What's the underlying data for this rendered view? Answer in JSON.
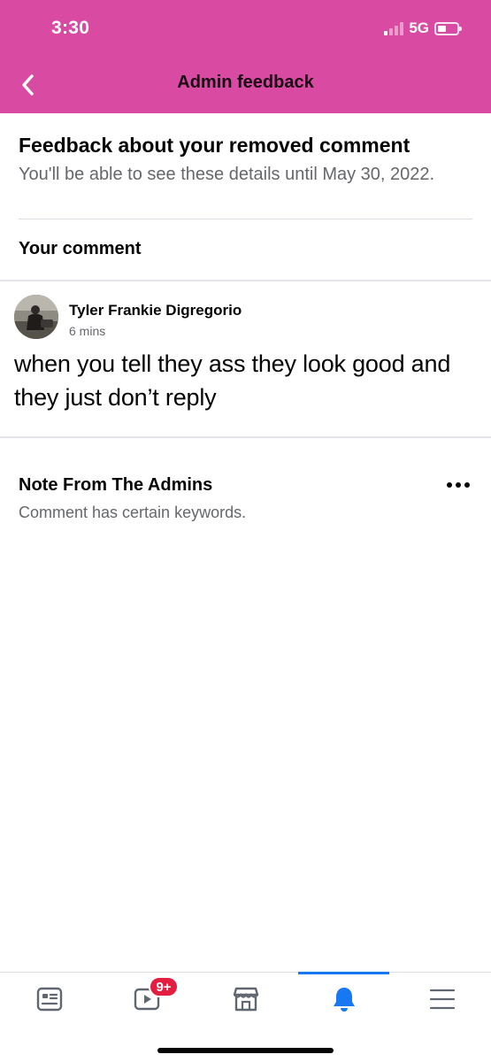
{
  "status_bar": {
    "time": "3:30",
    "network": "5G"
  },
  "header": {
    "title": "Admin feedback",
    "back_icon": "chevron-left-icon",
    "background_color": "#d94ba3"
  },
  "feedback": {
    "title": "Feedback about your removed comment",
    "subtitle": "You'll be able to see these details until May 30, 2022.",
    "section_label": "Your comment"
  },
  "comment": {
    "author": "Tyler Frankie Digregorio",
    "time": "6 mins",
    "text": "when you tell they ass they look good and they just don’t reply"
  },
  "note": {
    "title": "Note From The Admins",
    "text": "Comment has certain keywords.",
    "more_icon": "more-horizontal-icon"
  },
  "tabbar": {
    "tabs": [
      {
        "name": "tab-news-feed",
        "icon": "news-feed-icon"
      },
      {
        "name": "tab-watch",
        "icon": "video-icon"
      },
      {
        "name": "tab-marketplace",
        "icon": "store-icon"
      },
      {
        "name": "tab-notifications",
        "icon": "bell-icon"
      },
      {
        "name": "tab-menu",
        "icon": "hamburger-icon"
      }
    ],
    "watch_badge": "9+",
    "active_tab": "tab-notifications",
    "accent_color": "#1877f2"
  }
}
